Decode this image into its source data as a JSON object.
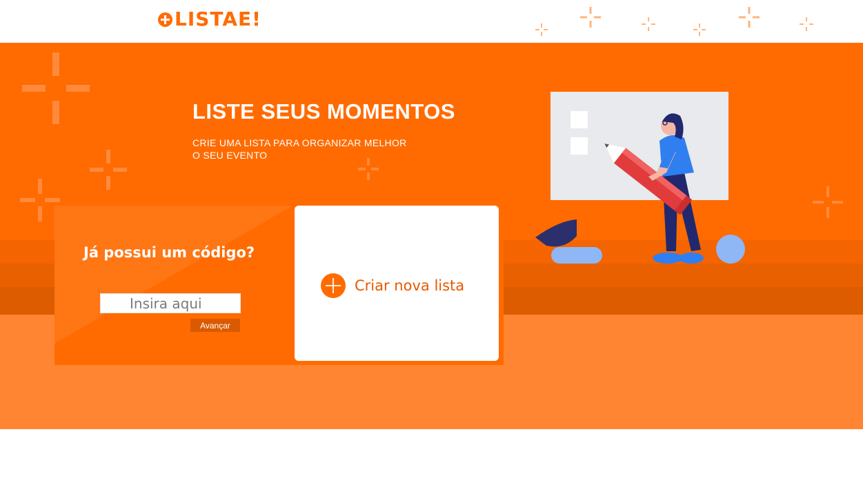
{
  "app": {
    "logo_text": "LISTAE!",
    "logo_icon": "plus-circle-icon",
    "brand_color": "#ff6b00"
  },
  "hero": {
    "title": "LISTE SEUS MOMENTOS",
    "subtitle": "CRIE UMA LISTA PARA ORGANIZAR MELHOR O SEU EVENTO",
    "background_color": "#ff6b00",
    "floor_color": "#ff8532"
  },
  "join": {
    "title": "Já possui um código?",
    "input_placeholder": "Insira aqui",
    "input_value": "",
    "button_label": "Avançar"
  },
  "create": {
    "label": "Criar nova lista",
    "icon": "plus-circle-icon"
  },
  "illustration": {
    "icon": "woman-holding-pencil-illustration"
  }
}
